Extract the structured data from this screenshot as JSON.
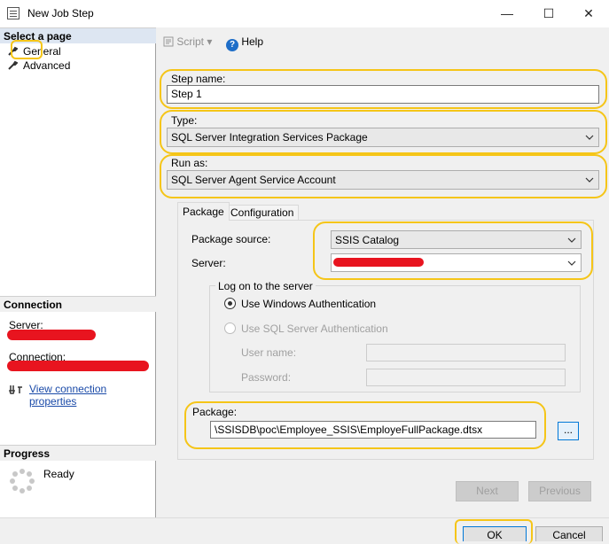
{
  "window": {
    "title": "New Job Step",
    "minimize": "—",
    "maximize": "☐",
    "close": "✕"
  },
  "left": {
    "select_page_header": "Select a page",
    "pages": [
      "General",
      "Advanced"
    ],
    "connection_header": "Connection",
    "server_label": "Server:",
    "connection_label": "Connection:",
    "view_connection_link": "View connection properties",
    "progress_header": "Progress",
    "progress_status": "Ready"
  },
  "toolbar": {
    "script_label": "Script",
    "help_label": "Help"
  },
  "form": {
    "step_name_label": "Step name:",
    "step_name_value": "Step 1",
    "type_label": "Type:",
    "type_value": "SQL Server Integration Services Package",
    "run_as_label": "Run as:",
    "run_as_value": "SQL Server Agent Service Account"
  },
  "tabs": [
    "Package",
    "Configuration"
  ],
  "package_tab": {
    "source_label": "Package source:",
    "source_value": "SSIS Catalog",
    "server_label": "Server:",
    "logon_group_title": "Log on to the server",
    "windows_auth_label": "Use Windows Authentication",
    "sql_auth_label": "Use SQL Server Authentication",
    "username_label": "User name:",
    "password_label": "Password:",
    "package_label": "Package:",
    "package_value": "\\SSISDB\\poc\\Employee_SSIS\\EmployeFullPackage.dtsx",
    "browse_label": "..."
  },
  "buttons": {
    "next": "Next",
    "previous": "Previous",
    "ok": "OK",
    "cancel": "Cancel"
  },
  "colors": {
    "highlight": "#f5c518",
    "redaction": "#e8141f",
    "link": "#1a4aa8"
  }
}
